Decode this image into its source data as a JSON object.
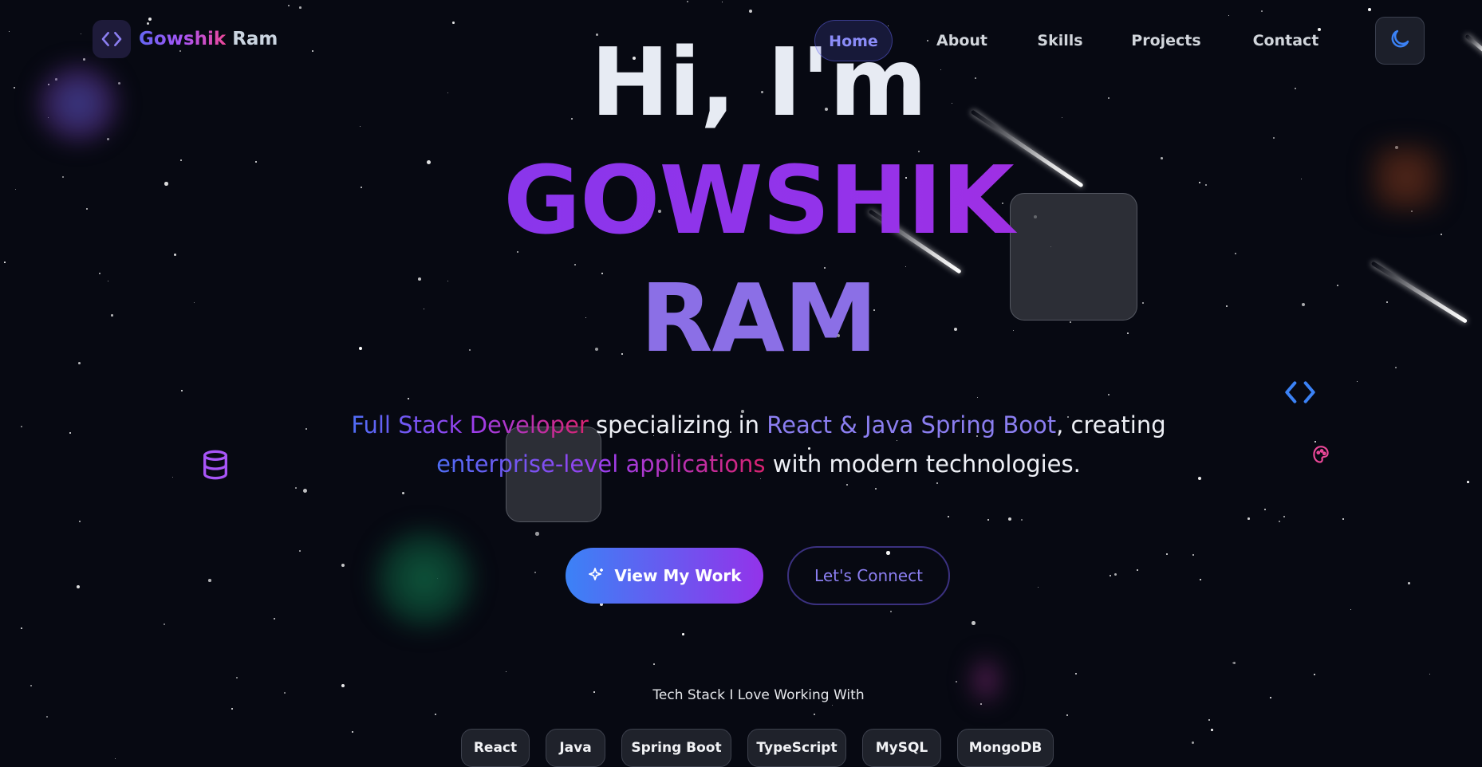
{
  "brand": {
    "first": "Gowshik",
    "last": "Ram",
    "icon": "code-icon"
  },
  "nav": {
    "items": [
      {
        "label": "Home",
        "active": true
      },
      {
        "label": "About",
        "active": false
      },
      {
        "label": "Skills",
        "active": false
      },
      {
        "label": "Projects",
        "active": false
      },
      {
        "label": "Contact",
        "active": false
      }
    ],
    "theme_toggle_icon": "moon-icon"
  },
  "hero": {
    "greeting": "Hi, I'm",
    "name_line1": "GOWSHIK",
    "name_line2": "RAM",
    "tagline": {
      "p1": "Full Stack Developer",
      "p2": " specializing in ",
      "p3": "React & Java Spring Boot",
      "p4": ", creating",
      "p5": "enterprise-level applications",
      "p6": " with modern technologies."
    },
    "primary_button": {
      "label": "View My Work",
      "icon": "sparkles-icon"
    },
    "secondary_button": {
      "label": "Let's Connect"
    }
  },
  "tech_stack": {
    "title": "Tech Stack I Love Working With",
    "items": [
      "React",
      "Java",
      "Spring Boot",
      "TypeScript",
      "MySQL",
      "MongoDB"
    ]
  },
  "decorations": {
    "icons": [
      "database-icon",
      "code-icon",
      "palette-icon"
    ]
  },
  "colors": {
    "background": "#070912",
    "accent_purple": "#9333ea",
    "accent_blue": "#3b82f6",
    "accent_pink": "#ec4899",
    "accent_indigo": "#6366f1"
  }
}
